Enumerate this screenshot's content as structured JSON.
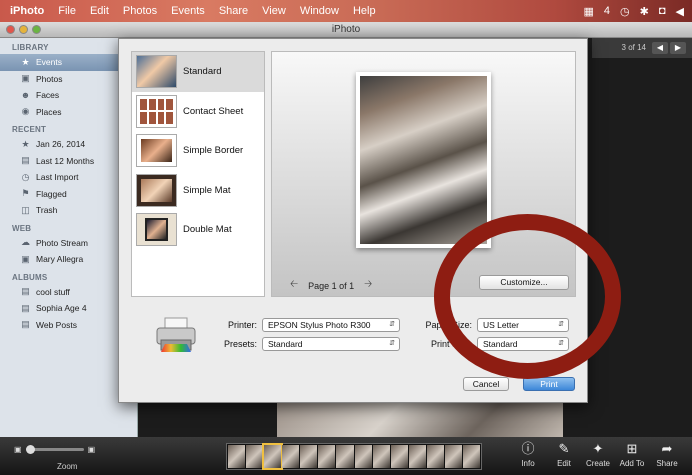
{
  "menubar": {
    "app_name": "iPhoto",
    "items": [
      "File",
      "Edit",
      "Photos",
      "Events",
      "Share",
      "View",
      "Window",
      "Help"
    ],
    "status": {
      "adobe_badge": "4"
    }
  },
  "window": {
    "title": "iPhoto"
  },
  "sidebar": {
    "sections": [
      {
        "header": "LIBRARY",
        "items": [
          {
            "label": "Events",
            "icon": "events-icon",
            "selected": true
          },
          {
            "label": "Photos",
            "icon": "photos-icon"
          },
          {
            "label": "Faces",
            "icon": "faces-icon"
          },
          {
            "label": "Places",
            "icon": "places-icon"
          }
        ]
      },
      {
        "header": "RECENT",
        "items": [
          {
            "label": "Jan 26, 2014",
            "icon": "event-icon"
          },
          {
            "label": "Last 12 Months",
            "icon": "calendar-icon"
          },
          {
            "label": "Last Import",
            "icon": "import-icon"
          },
          {
            "label": "Flagged",
            "icon": "flag-icon"
          },
          {
            "label": "Trash",
            "icon": "trash-icon"
          }
        ]
      },
      {
        "header": "WEB",
        "items": [
          {
            "label": "Photo Stream",
            "icon": "photo-stream-icon"
          },
          {
            "label": "Mary Allegra",
            "icon": "facebook-icon"
          }
        ]
      },
      {
        "header": "ALBUMS",
        "items": [
          {
            "label": "cool stuff",
            "icon": "album-icon"
          },
          {
            "label": "Sophia Age 4",
            "icon": "album-icon"
          },
          {
            "label": "Web Posts",
            "icon": "album-icon"
          }
        ]
      }
    ]
  },
  "viewer": {
    "count": "3 of 14"
  },
  "print_dialog": {
    "themes": [
      {
        "label": "Standard",
        "selected": true
      },
      {
        "label": "Contact Sheet"
      },
      {
        "label": "Simple Border"
      },
      {
        "label": "Simple Mat"
      },
      {
        "label": "Double Mat"
      }
    ],
    "pager": "Page 1 of 1",
    "customize_label": "Customize...",
    "printer_label": "Printer:",
    "printer_value": "EPSON Stylus Photo R300",
    "presets_label": "Presets:",
    "presets_value": "Standard",
    "paper_size_label": "Paper Size:",
    "paper_size_value": "US Letter",
    "print_size_label": "Print Size:",
    "print_size_value": "Standard",
    "cancel_label": "Cancel",
    "print_label": "Print"
  },
  "bottombar": {
    "zoom_label": "Zoom",
    "tools": [
      {
        "label": "Info",
        "icon": "info-icon"
      },
      {
        "label": "Edit",
        "icon": "edit-icon"
      },
      {
        "label": "Create",
        "icon": "create-icon"
      },
      {
        "label": "Add To",
        "icon": "add-to-icon"
      },
      {
        "label": "Share",
        "icon": "share-icon"
      }
    ]
  }
}
